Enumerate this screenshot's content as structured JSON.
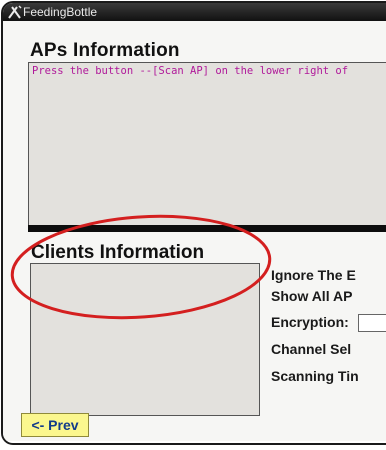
{
  "window": {
    "title": "FeedingBottle"
  },
  "aps": {
    "heading": "APs Information",
    "message": "Press the button --[Scan AP] on the lower right of"
  },
  "clients": {
    "heading": "Clients Information"
  },
  "settings": {
    "ignore_label": "Ignore The E",
    "show_all_label": "Show All AP",
    "encryption_label": "Encryption:",
    "channel_label": "Channel Sel",
    "scanning_label": "Scanning Tin"
  },
  "nav": {
    "prev_label": "<- Prev"
  },
  "colors": {
    "highlight": "#d41f1f",
    "button_bg": "#fbf78e",
    "message_text": "#b0199a"
  }
}
